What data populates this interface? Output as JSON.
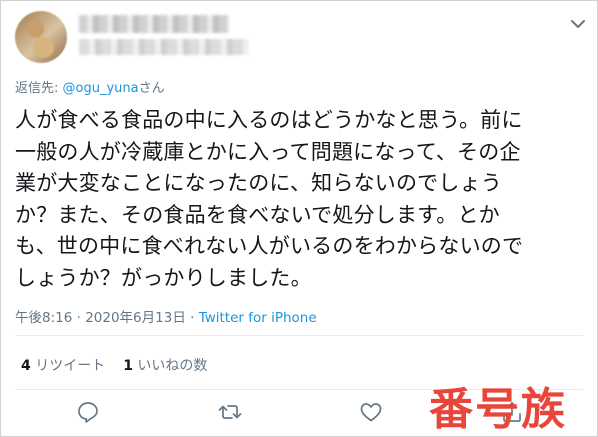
{
  "tweet": {
    "reply_prefix": "返信先: ",
    "reply_handle": "@ogu_yuna",
    "reply_suffix": "さん",
    "text_lines": [
      "人が食べる食品の中に入るのはどうかなと思う。前に",
      "一般の人が冷蔵庫とかに入って問題になって、その企",
      "業が大変なことになったのに、知らないのでしょう",
      "か？また、その食品を食べないで処分します。とか",
      "も、世の中に食べれない人がいるのをわからないので",
      "しょうか？がっかりしました。"
    ],
    "time": "午後8:16",
    "dot": " · ",
    "date": "2020年6月13日",
    "client": "Twitter for iPhone"
  },
  "stats": {
    "retweets_count": "4",
    "retweets_label": "リツイート",
    "likes_count": "1",
    "likes_label": "いいねの数"
  },
  "actions": [
    "reply-icon",
    "retweet-icon",
    "like-icon",
    "share-icon"
  ],
  "watermark": "番号族",
  "colors": {
    "link": "#1b95e0",
    "muted": "#657786",
    "text": "#14171a",
    "watermark": "#e8463a"
  }
}
